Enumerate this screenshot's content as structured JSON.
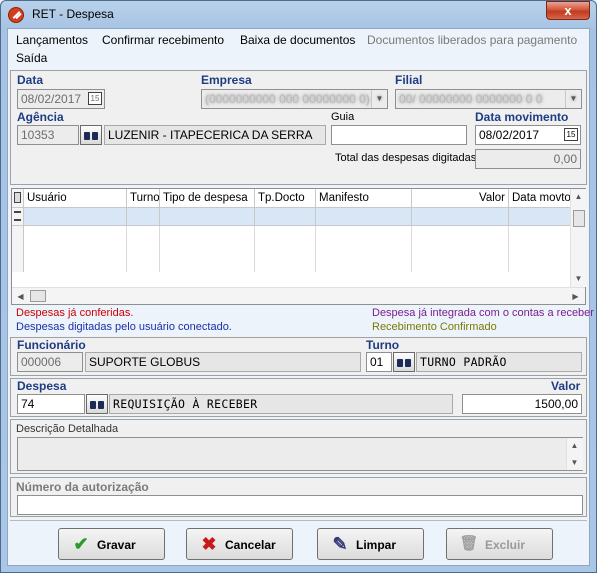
{
  "window": {
    "title": "RET - Despesa",
    "close_label": "x"
  },
  "menu": {
    "items": [
      "Lançamentos",
      "Confirmar recebimento",
      "Baixa de documentos",
      "Documentos liberados para pagamento",
      "Saída"
    ]
  },
  "header": {
    "data_label": "Data",
    "data_value": "08/02/2017",
    "empresa_label": "Empresa",
    "empresa_value": "(0000000000 000 00000000 0)",
    "filial_label": "Filial",
    "filial_value": "00/ 00000000 0000000 0 0",
    "agencia_label": "Agência",
    "agencia_code": "10353",
    "agencia_name": "LUZENIR - ITAPECERICA DA SERRA",
    "guia_label": "Guia",
    "guia_value": "",
    "data_movimento_label": "Data movimento",
    "data_movimento_value": "08/02/2017",
    "total_label": "Total das despesas digitadas",
    "total_value": "0,00",
    "calendar_glyph": "15"
  },
  "grid": {
    "columns": [
      "Usuário",
      "Turno",
      "Tipo de despesa",
      "Tp.Docto",
      "Manifesto",
      "Valor",
      "Data movto"
    ]
  },
  "legend": {
    "conferidas": "Despesas já conferidas.",
    "conectado": "Despesas digitadas pelo usuário conectado.",
    "integrada": "Despesa já integrada com o contas a receber",
    "confirmado": "Recebimento Confirmado",
    "colors": {
      "conferidas": "#cc0000",
      "conectado": "#1a2fa8",
      "integrada": "#7a1f8c",
      "confirmado": "#7a7a00"
    }
  },
  "funcionario": {
    "label": "Funcionário",
    "code": "000006",
    "name": "SUPORTE GLOBUS",
    "turno_label": "Turno",
    "turno_code": "01",
    "turno_name": "TURNO PADRÃO"
  },
  "despesa": {
    "label": "Despesa",
    "code": "74",
    "name": "REQUISIÇÃO À RECEBER",
    "valor_label": "Valor",
    "valor_value": "1500,00"
  },
  "descricao": {
    "label": "Descrição Detalhada",
    "value": ""
  },
  "autorizacao": {
    "label": "Número da autorização",
    "value": ""
  },
  "buttons": {
    "gravar": "Gravar",
    "cancelar": "Cancelar",
    "limpar": "Limpar",
    "excluir": "Excluir"
  },
  "icons": {
    "app": "ret-app-icon",
    "calendar": "calendar-icon",
    "binoculars": "binoculars-icon",
    "check": "check-icon",
    "x": "x-icon",
    "eraser": "eraser-icon",
    "trash": "trash-icon"
  }
}
